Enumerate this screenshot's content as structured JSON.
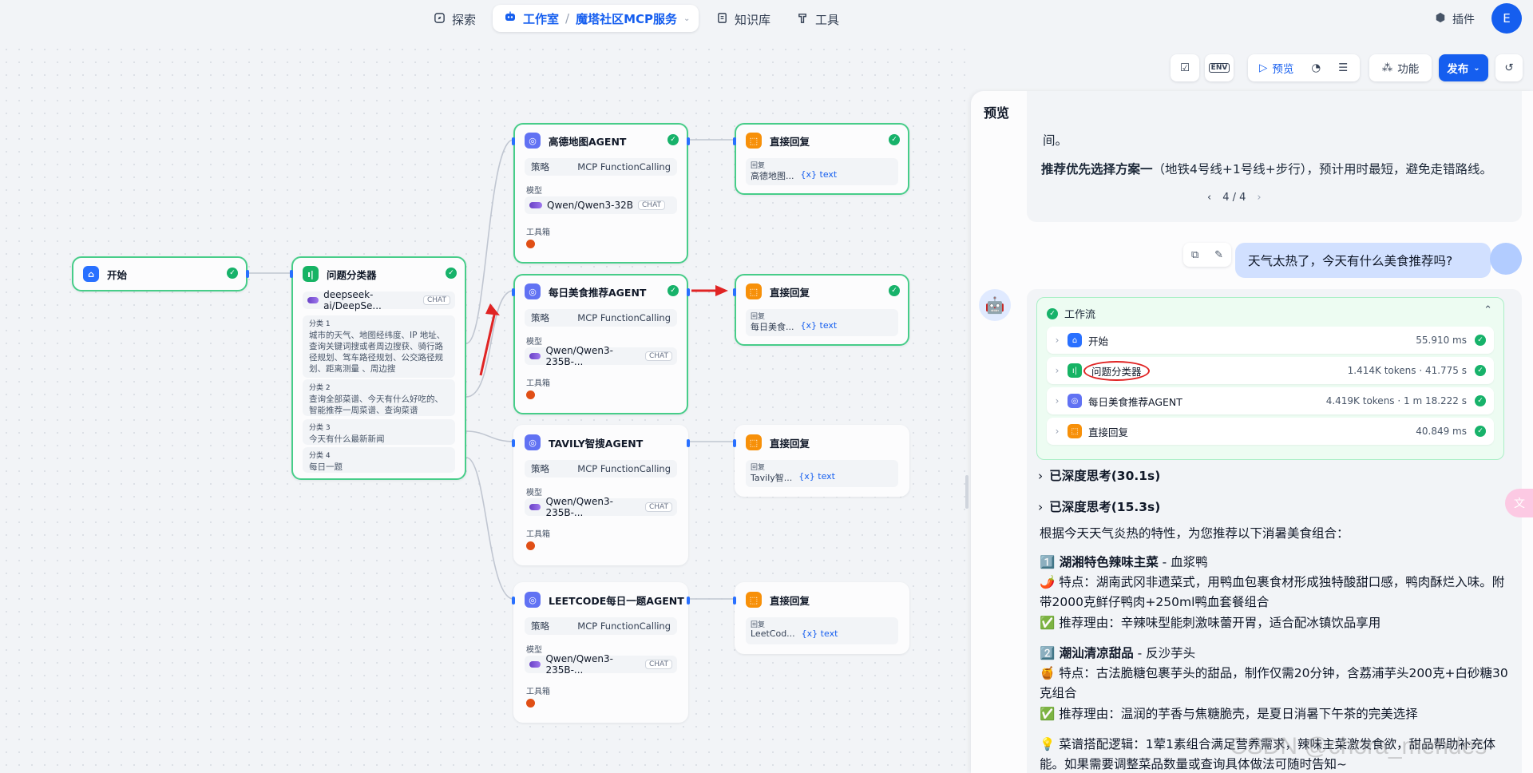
{
  "nav": {
    "explore": "探索",
    "studio": "工作室",
    "app_name": "魔塔社区MCP服务",
    "knowledge": "知识库",
    "tools": "工具",
    "plugins": "插件",
    "avatar_initial": "E"
  },
  "toolbar": {
    "env": "ENV",
    "preview": "预览",
    "features": "功能",
    "publish": "发布"
  },
  "nodes": {
    "start": {
      "title": "开始"
    },
    "classifier": {
      "title": "问题分类器",
      "model": "deepseek-ai/DeepSe...",
      "model_tag": "CHAT",
      "classes": [
        {
          "label": "分类 1",
          "text": "城市的天气、地图经纬度、IP 地址、查询关键词搜或者周边搜获、骑行路径规划、驾车路径规划、公交路径规划、距离测量 、周边搜"
        },
        {
          "label": "分类 2",
          "text": "查询全部菜谱、今天有什么好吃的、智能推荐一周菜谱、查询菜谱"
        },
        {
          "label": "分类 3",
          "text": "今天有什么最新新闻"
        },
        {
          "label": "分类 4",
          "text": "每日一题"
        }
      ]
    },
    "agents": [
      {
        "title": "高德地图AGENT",
        "strategy_label": "策略",
        "strategy": "MCP FunctionCalling",
        "model_label": "模型",
        "model": "Qwen/Qwen3-32B",
        "model_tag": "CHAT",
        "tools_label": "工具箱"
      },
      {
        "title": "每日美食推荐AGENT",
        "strategy_label": "策略",
        "strategy": "MCP FunctionCalling",
        "model_label": "模型",
        "model": "Qwen/Qwen3-235B-...",
        "model_tag": "CHAT",
        "tools_label": "工具箱"
      },
      {
        "title": "TAVILY智搜AGENT",
        "strategy_label": "策略",
        "strategy": "MCP FunctionCalling",
        "model_label": "模型",
        "model": "Qwen/Qwen3-235B-...",
        "model_tag": "CHAT",
        "tools_label": "工具箱"
      },
      {
        "title": "LEETCODE每日一题AGENT",
        "strategy_label": "策略",
        "strategy": "MCP FunctionCalling",
        "model_label": "模型",
        "model": "Qwen/Qwen3-235B-...",
        "model_tag": "CHAT",
        "tools_label": "工具箱"
      }
    ],
    "replies": [
      {
        "title": "直接回复",
        "label": "回复",
        "source": "高德地图...",
        "var": "{x} text"
      },
      {
        "title": "直接回复",
        "label": "回复",
        "source": "每日美食...",
        "var": "{x} text"
      },
      {
        "title": "直接回复",
        "label": "回复",
        "source": "Tavily智...",
        "var": "{x} text"
      },
      {
        "title": "直接回复",
        "label": "回复",
        "source": "LeetCod...",
        "var": "{x} text"
      }
    ]
  },
  "preview": {
    "title": "预览",
    "prev_tail": "间。",
    "prev_recommend_bold": "推荐优先选择方案一",
    "prev_recommend_rest": "（地铁4号线+1号线+步行），预计用时最短，避免走错路线。",
    "pager": "4 / 4",
    "question": "天气太热了，今天有什么美食推荐吗?",
    "workflow_label": "工作流",
    "workflow_steps": [
      {
        "name": "开始",
        "meta": "55.910 ms"
      },
      {
        "name": "问题分类器",
        "meta": "1.414K tokens · 41.775 s"
      },
      {
        "name": "每日美食推荐AGENT",
        "meta": "4.419K tokens · 1 m 18.222 s"
      },
      {
        "name": "直接回复",
        "meta": "40.849 ms"
      }
    ],
    "think1": "已深度思考(30.1s)",
    "think2": "已深度思考(15.3s)",
    "intro": "根据今天天气炎热的特性，为您推荐以下消暑美食组合：",
    "dish1_title": "1️⃣ 湖湘特色辣味主菜",
    "dish1_name": " - 血浆鸭",
    "dish1_feature": "🌶️ 特点：湖南武冈非遗菜式，用鸭血包裹食材形成独特酸甜口感，鸭肉酥烂入味。附带2000克鲜仔鸭肉+250ml鸭血套餐组合",
    "dish1_reason": "✅ 推荐理由：辛辣味型能刺激味蕾开胃，适合配冰镇饮品享用",
    "dish2_title": "2️⃣ 潮汕清凉甜品",
    "dish2_name": " - 反沙芋头",
    "dish2_feature": "🍯 特点：古法脆糖包裹芋头的甜品，制作仅需20分钟，含荔浦芋头200克+白砂糖30克组合",
    "dish2_reason": "✅ 推荐理由：温润的芋香与焦糖脆壳，是夏日消暑下午茶的完美选择",
    "logic": "💡 菜谱搭配逻辑：1荤1素组合满足营养需求，辣味主菜激发食欲，甜品帮助补充体能。如果需要调整菜品数量或查询具体做法可随时告知~"
  },
  "watermark": "CSDN @chora_mendes",
  "colors": {
    "accent": "#155eef",
    "success": "#17b26a",
    "annotation": "#e02424"
  }
}
